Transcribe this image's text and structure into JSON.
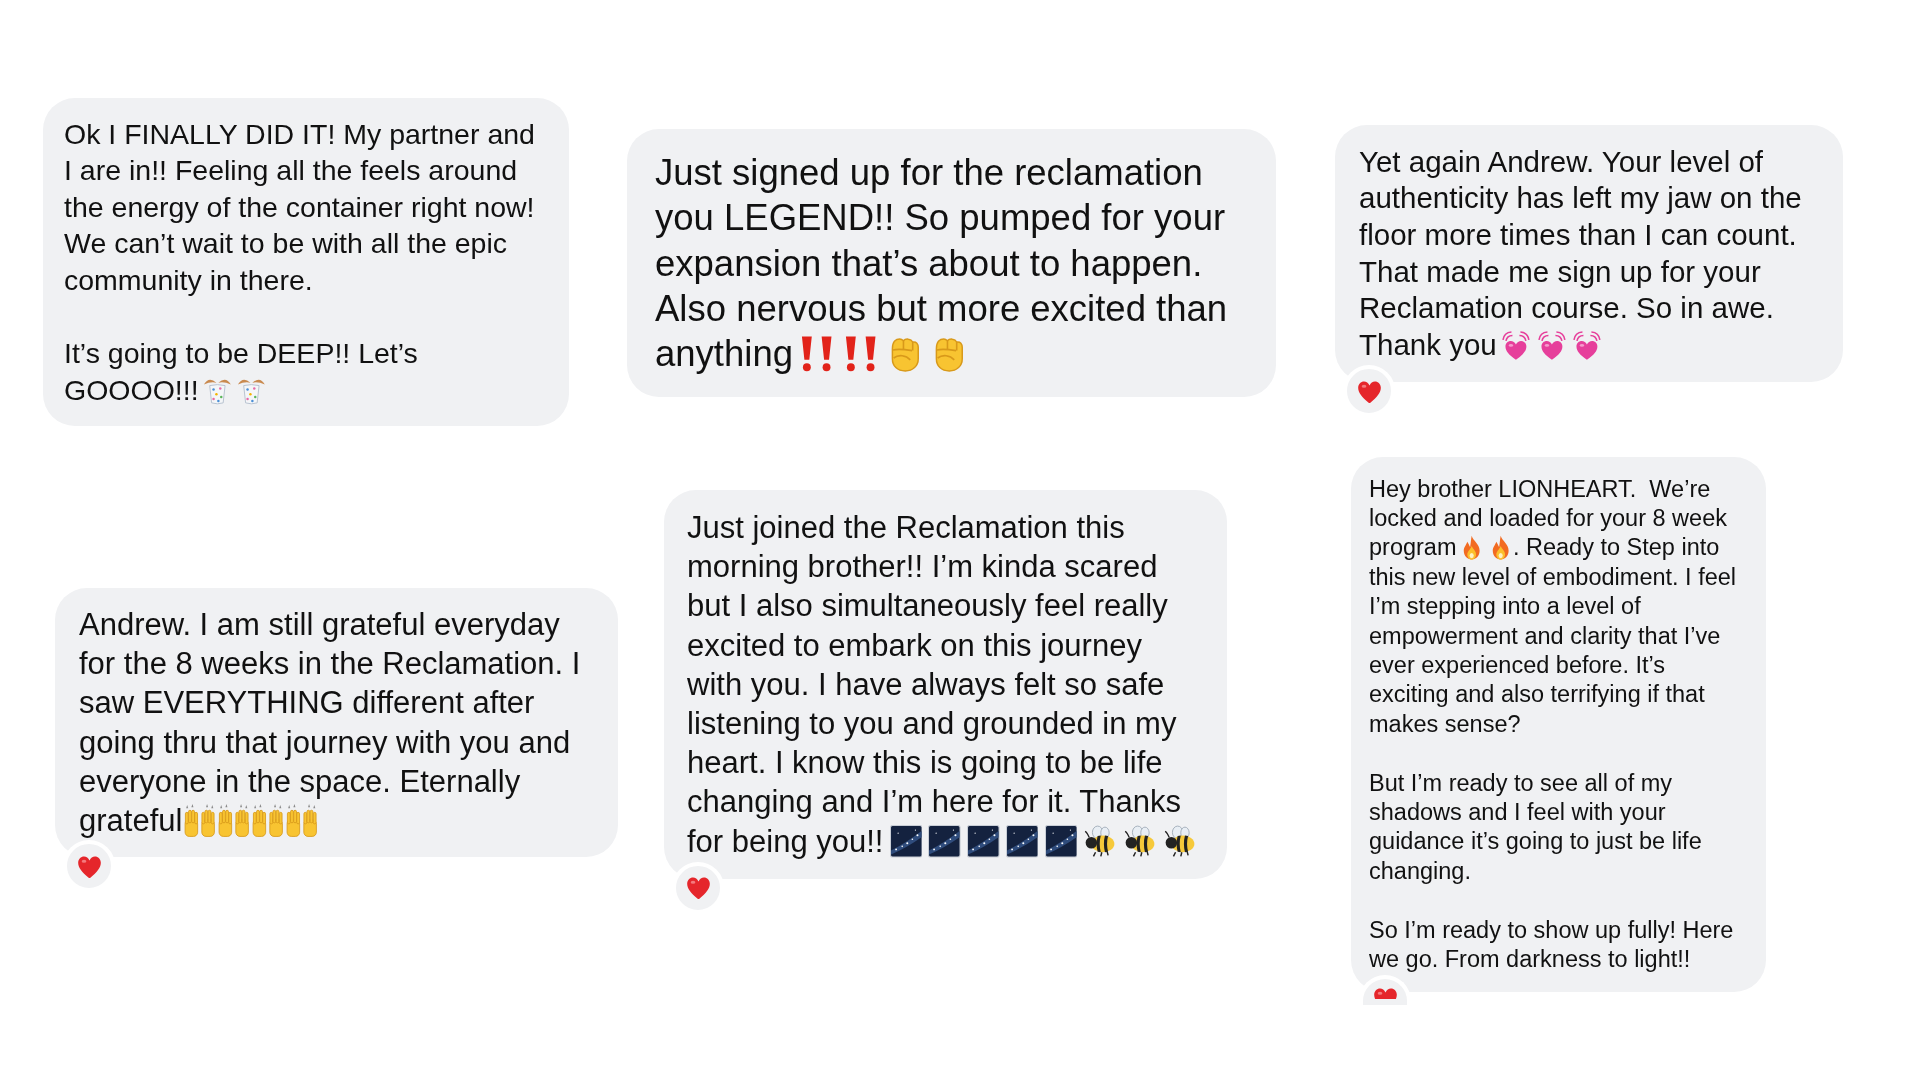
{
  "messages": [
    {
      "paragraphs": [
        {
          "rows": [
            {
              "parts": [
                {
                  "kind": "text",
                  "text": "Ok I FINALLY DID IT! My partner and I are in!! Feeling all the feels around the energy of the container right now! We can’t wait to be with all the epic community in there."
                }
              ]
            }
          ]
        },
        {
          "rows": [
            {
              "parts": [
                {
                  "kind": "text",
                  "text": "It’s going to be DEEP!! Let’s"
                }
              ]
            },
            {
              "parts": [
                {
                  "kind": "text",
                  "text": "GOOOO!!!"
                },
                {
                  "kind": "confetti"
                },
                {
                  "kind": "confetti"
                }
              ]
            }
          ]
        }
      ],
      "reacted": false
    },
    {
      "paragraphs": [
        {
          "rows": [
            {
              "parts": [
                {
                  "kind": "text",
                  "text": "Just signed up for the reclamation you LEGEND!! So pumped for your expansion that’s about to happen. Also nervous but more excited than"
                }
              ]
            },
            {
              "parts": [
                {
                  "kind": "text",
                  "text": "anything"
                },
                {
                  "kind": "exclamation"
                },
                {
                  "kind": "exclamation"
                },
                {
                  "kind": "fist"
                },
                {
                  "kind": "fist"
                }
              ]
            }
          ]
        }
      ],
      "reacted": false
    },
    {
      "paragraphs": [
        {
          "rows": [
            {
              "parts": [
                {
                  "kind": "text",
                  "text": "Yet again Andrew. Your level of authenticity has left my jaw on the floor more times than I can count. That made me sign up for your Reclamation course. So in awe."
                }
              ]
            },
            {
              "parts": [
                {
                  "kind": "text",
                  "text": "Thank you"
                },
                {
                  "kind": "heartbeat"
                },
                {
                  "kind": "heartbeat"
                },
                {
                  "kind": "heartbeat"
                }
              ]
            }
          ]
        }
      ],
      "reacted": true
    },
    {
      "paragraphs": [
        {
          "rows": [
            {
              "parts": [
                {
                  "kind": "text",
                  "text": "Andrew. I am still grateful everyday for the 8 weeks in the Reclamation. I saw EVERYTHING different after going thru that journey with you and everyone in the space. Eternally"
                }
              ]
            },
            {
              "parts": [
                {
                  "kind": "text",
                  "text": "grateful"
                },
                {
                  "kind": "hands"
                },
                {
                  "kind": "hands"
                },
                {
                  "kind": "hands"
                },
                {
                  "kind": "hands"
                }
              ]
            }
          ]
        }
      ],
      "reacted": true
    },
    {
      "paragraphs": [
        {
          "rows": [
            {
              "parts": [
                {
                  "kind": "text",
                  "text": "Just joined the Reclamation this morning brother!! I’m kinda scared but I also simultaneously feel really excited to embark on this journey with you. I have always felt so safe listening to you and grounded in my heart. I know this is going to be life changing and I’m here for it. Thanks"
                }
              ]
            },
            {
              "parts": [
                {
                  "kind": "text",
                  "text": "for being you!!"
                },
                {
                  "kind": "galaxy"
                },
                {
                  "kind": "galaxy"
                },
                {
                  "kind": "galaxy"
                },
                {
                  "kind": "galaxy"
                },
                {
                  "kind": "galaxy"
                },
                {
                  "kind": "bee"
                },
                {
                  "kind": "bee"
                },
                {
                  "kind": "bee"
                }
              ]
            }
          ]
        }
      ],
      "reacted": true
    },
    {
      "paragraphs": [
        {
          "rows": [
            {
              "parts": [
                {
                  "kind": "text",
                  "text": "Hey brother LIONHEART.  We’re locked and loaded for your 8 week"
                }
              ]
            },
            {
              "parts": [
                {
                  "kind": "text",
                  "text": "program"
                },
                {
                  "kind": "fire"
                },
                {
                  "kind": "fire"
                },
                {
                  "kind": "text",
                  "text": ". Ready to Step into"
                }
              ]
            },
            {
              "parts": [
                {
                  "kind": "text",
                  "text": "this new level of embodiment. I feel I’m stepping into a level of empowerment and clarity that I’ve ever experienced before. It’s exciting and also terrifying if that makes sense?"
                }
              ]
            }
          ]
        },
        {
          "rows": [
            {
              "parts": [
                {
                  "kind": "text",
                  "text": "But I’m ready to see all of my shadows and I feel with your guidance it’s going to just be life changing."
                }
              ]
            }
          ]
        },
        {
          "rows": [
            {
              "parts": [
                {
                  "kind": "text",
                  "text": "So I’m ready to show up fully! Here we go. From darkness to light!!"
                }
              ]
            }
          ]
        }
      ],
      "reacted": true
    }
  ]
}
